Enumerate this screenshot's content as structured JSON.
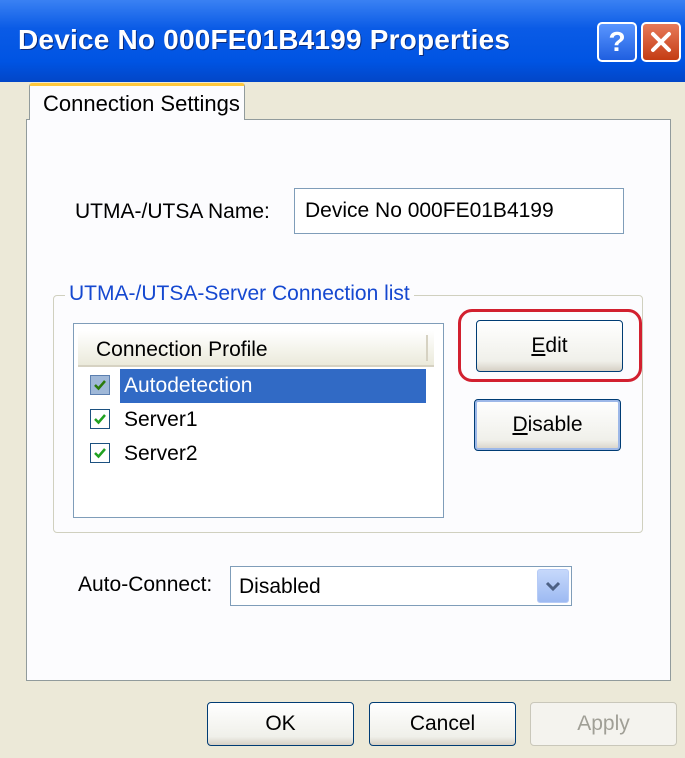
{
  "window": {
    "title": "Device No  000FE01B4199 Properties",
    "help_label": "?",
    "close_icon": "close-icon"
  },
  "tabs": [
    {
      "label": "Connection Settings",
      "selected": true
    }
  ],
  "name_field": {
    "label": "UTMA-/UTSA Name:",
    "value": "Device No  000FE01B4199"
  },
  "connection_group": {
    "title": "UTMA-/UTSA-Server Connection list",
    "column_header": "Connection Profile",
    "profiles": [
      {
        "label": "Autodetection",
        "checked": true,
        "selected": true
      },
      {
        "label": "Server1",
        "checked": true,
        "selected": false
      },
      {
        "label": "Server2",
        "checked": true,
        "selected": false
      }
    ],
    "edit_label": "Edit",
    "edit_mnemonic": "E",
    "edit_rest": "dit",
    "disable_label": "Disable",
    "disable_mnemonic": "D",
    "disable_rest": "isable"
  },
  "auto_connect": {
    "label": "Auto-Connect:",
    "value": "Disabled"
  },
  "footer": {
    "ok_label": "OK",
    "cancel_label": "Cancel",
    "apply_label": "Apply"
  },
  "colors": {
    "titlebar": "#0054E3",
    "highlight_ring": "#D2202F",
    "selection": "#316AC5",
    "group_title": "#1548D0"
  }
}
